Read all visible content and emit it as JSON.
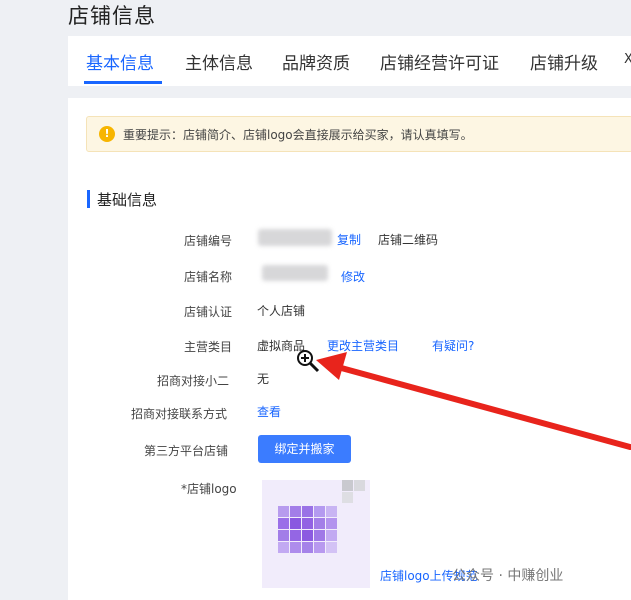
{
  "page": {
    "title": "店铺信息"
  },
  "tabs": [
    {
      "label": "基本信息",
      "active": true
    },
    {
      "label": "主体信息"
    },
    {
      "label": "品牌资质"
    },
    {
      "label": "店铺经营许可证"
    },
    {
      "label": "店铺升级"
    },
    {
      "label": "X"
    }
  ],
  "notice": {
    "icon": "warning-icon",
    "text": "重要提示：店铺简介、店铺logo会直接展示给买家，请认真填写。"
  },
  "section": {
    "title": "基础信息"
  },
  "fields": {
    "shop_id": {
      "label": "店铺编号",
      "copy_link": "复制",
      "qr_link": "店铺二维码"
    },
    "shop_name": {
      "label": "店铺名称",
      "edit_link": "修改"
    },
    "shop_cert": {
      "label": "店铺认证",
      "value": "个人店铺"
    },
    "category": {
      "label": "主营类目",
      "value": "虚拟商品",
      "change_link": "更改主营类目",
      "question_link": "有疑问?"
    },
    "merchant_rep": {
      "label": "招商对接小二",
      "value": "无"
    },
    "merchant_contact": {
      "label": "招商对接联系方式",
      "view_link": "查看"
    },
    "third_party": {
      "label": "第三方平台店铺",
      "button": "绑定并搬家"
    },
    "shop_logo": {
      "label": "*店铺logo",
      "link": "店铺logo上传规范"
    }
  },
  "watermark": "公众号 · 中赚创业",
  "colors": {
    "accent": "#1966ff",
    "arrow": "#e8241c",
    "notice_bg": "#fdf6e3"
  }
}
